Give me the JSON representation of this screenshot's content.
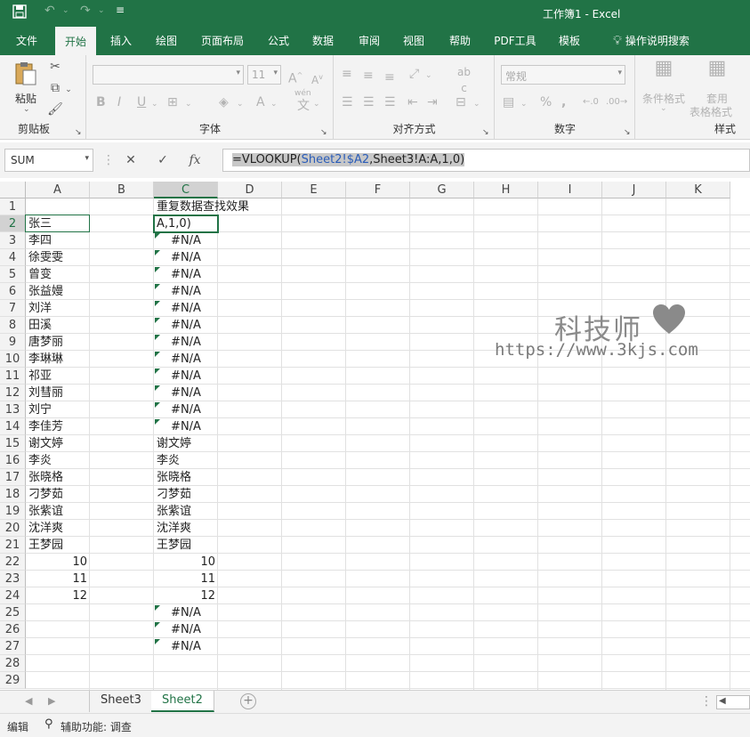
{
  "titlebar": {
    "title": "工作簿1  -  Excel",
    "save_icon": "save-icon",
    "undo_icon": "undo-icon",
    "redo_icon": "redo-icon",
    "customize_icon": "customize-qat-icon"
  },
  "tabs": [
    "文件",
    "开始",
    "插入",
    "绘图",
    "页面布局",
    "公式",
    "数据",
    "审阅",
    "视图",
    "帮助",
    "PDF工具",
    "模板",
    "操作说明搜索"
  ],
  "active_tab": "开始",
  "ribbon": {
    "clipboard": {
      "paste_label": "粘贴",
      "group_label": "剪贴板"
    },
    "font": {
      "font_size": "11",
      "group_label": "字体",
      "wen_label": "wén"
    },
    "alignment": {
      "group_label": "对齐方式"
    },
    "number": {
      "format": "常规",
      "group_label": "数字"
    },
    "styles": {
      "cond_format": "条件格式",
      "table_format_1": "套用",
      "table_format_2": "表格格式",
      "group_label": "样式"
    }
  },
  "formula_bar": {
    "name_box": "SUM",
    "formula_prefix": "=VLOOKUP(",
    "formula_ref": "Sheet2!$A2",
    "formula_suffix": ",Sheet3!A:A,1,0)"
  },
  "columns": [
    "A",
    "B",
    "C",
    "D",
    "E",
    "F",
    "G",
    "H",
    "I",
    "J",
    "K"
  ],
  "active_column": "C",
  "rows": [
    {
      "n": "1",
      "a": "",
      "c": "重复数据查找效果"
    },
    {
      "n": "2",
      "a": "张三",
      "c": "A,1,0)"
    },
    {
      "n": "3",
      "a": "李四",
      "c": "#N/A"
    },
    {
      "n": "4",
      "a": "徐雯雯",
      "c": "#N/A"
    },
    {
      "n": "5",
      "a": "曾变",
      "c": "#N/A"
    },
    {
      "n": "6",
      "a": "张益嫚",
      "c": "#N/A"
    },
    {
      "n": "7",
      "a": "刘洋",
      "c": "#N/A"
    },
    {
      "n": "8",
      "a": "田溪",
      "c": "#N/A"
    },
    {
      "n": "9",
      "a": "唐梦丽",
      "c": "#N/A"
    },
    {
      "n": "10",
      "a": "李琳琳",
      "c": "#N/A"
    },
    {
      "n": "11",
      "a": "祁亚",
      "c": "#N/A"
    },
    {
      "n": "12",
      "a": "刘彗丽",
      "c": "#N/A"
    },
    {
      "n": "13",
      "a": "刘宁",
      "c": "#N/A"
    },
    {
      "n": "14",
      "a": "李佳芳",
      "c": "#N/A"
    },
    {
      "n": "15",
      "a": "谢文婷",
      "c": "谢文婷"
    },
    {
      "n": "16",
      "a": "李炎",
      "c": "李炎"
    },
    {
      "n": "17",
      "a": "张晓格",
      "c": "张晓格"
    },
    {
      "n": "18",
      "a": "刁梦茹",
      "c": "刁梦茹"
    },
    {
      "n": "19",
      "a": "张紫谊",
      "c": "张紫谊"
    },
    {
      "n": "20",
      "a": "沈洋爽",
      "c": "沈洋爽"
    },
    {
      "n": "21",
      "a": "王梦园",
      "c": "王梦园"
    },
    {
      "n": "22",
      "a": "10",
      "c": "10"
    },
    {
      "n": "23",
      "a": "11",
      "c": "11"
    },
    {
      "n": "24",
      "a": "12",
      "c": "12"
    },
    {
      "n": "25",
      "a": "",
      "c": "#N/A"
    },
    {
      "n": "26",
      "a": "",
      "c": "#N/A"
    },
    {
      "n": "27",
      "a": "",
      "c": "#N/A"
    },
    {
      "n": "28",
      "a": "",
      "c": ""
    },
    {
      "n": "29",
      "a": "",
      "c": ""
    }
  ],
  "watermark": {
    "name": "科技师",
    "url": "https://www.3kjs.com",
    "color": "#8a8a8a"
  },
  "sheets": [
    "Sheet3",
    "Sheet2"
  ],
  "active_sheet": "Sheet2",
  "status": {
    "mode": "编辑",
    "accessibility": "辅助功能: 调查"
  },
  "colors": {
    "accent": "#217346",
    "ribbon_bg": "#f3f3f3",
    "formula_ref": "#2a5cb8"
  }
}
